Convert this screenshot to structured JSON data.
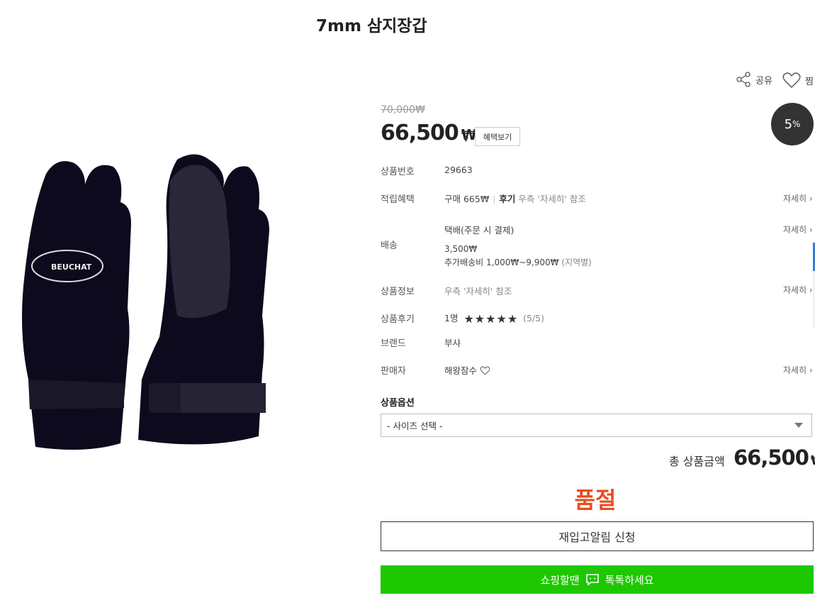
{
  "product": {
    "title": "7mm 삼지장갑",
    "original_price": "70,000₩",
    "price": "66,500",
    "currency": "₩",
    "benefit_button": "혜택보기",
    "discount": "5",
    "discount_unit": "%"
  },
  "actions": {
    "share_label": "공유",
    "wish_label": "찜"
  },
  "info": {
    "product_no_label": "상품번호",
    "product_no": "29663",
    "points_label": "적립혜택",
    "points_purchase": "구매 665₩",
    "points_review": "후기",
    "points_review_note": "우측 '자세히' 참조",
    "shipping_label": "배송",
    "shipping_method": "택배(주문 시 결제)",
    "shipping_fee": "3,500₩",
    "shipping_extra": "추가배송비 1,000₩~9,900₩",
    "shipping_extra_note": "(지역별)",
    "info_label": "상품정보",
    "info_value": "우측 '자세히' 참조",
    "review_label": "상품후기",
    "review_count": "1명",
    "review_score": "(5/5)",
    "rating": 5,
    "brand_label": "브랜드",
    "brand": "부샤",
    "seller_label": "판매자",
    "seller": "해왕잠수",
    "more_label": "자세히 ›"
  },
  "options": {
    "label": "상품옵션",
    "size_select": "- 사이즈 선택 -"
  },
  "total": {
    "label": "총 상품금액",
    "value": "66,500",
    "currency": "₩"
  },
  "status": {
    "soldout": "품절"
  },
  "buttons": {
    "restock": "재입고알림 신청",
    "talk_prefix": "쇼핑할땐",
    "talk_suffix": "톡톡하세요"
  },
  "colors": {
    "soldout": "#e94d1f",
    "talk": "#1ec800",
    "badge": "#333333"
  }
}
